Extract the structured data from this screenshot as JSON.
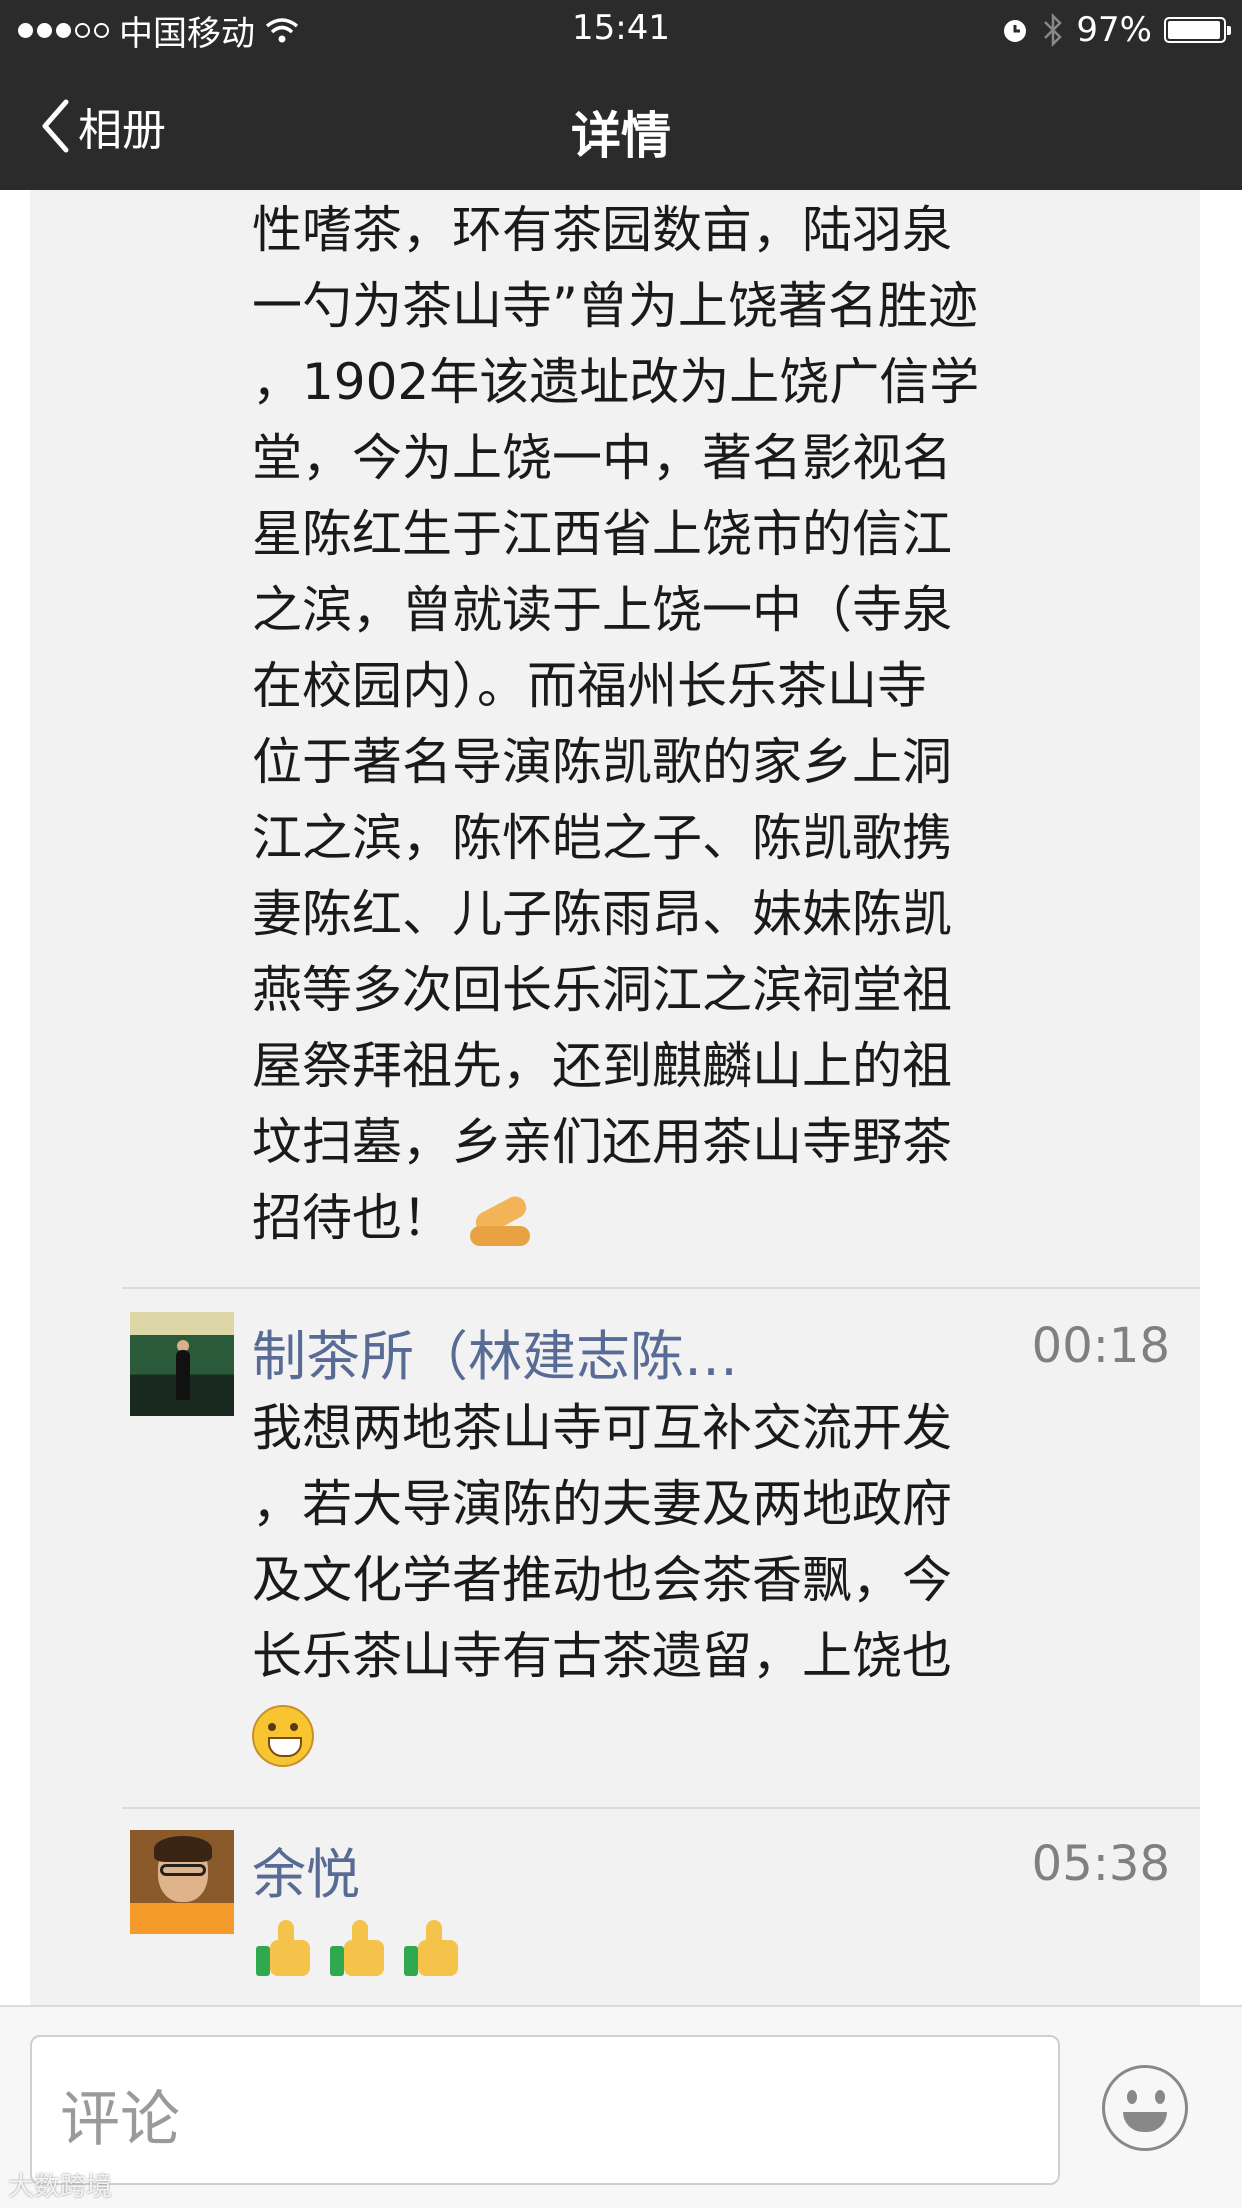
{
  "status_bar": {
    "carrier": "中国移动",
    "time": "15:41",
    "battery_percent": "97%",
    "battery_level": 0.97
  },
  "nav": {
    "back_label": "相册",
    "title": "详情"
  },
  "post": {
    "text": "性嗜茶，环有茶园数亩，陆羽泉\n一勺为茶山寺”曾为上饶著名胜迹\n，1902年该遗址改为上饶广信学\n堂，今为上饶一中，著名影视名\n星陈红生于江西省上饶市的信江\n之滨，曾就读于上饶一中（寺泉\n在校园内）。而福州长乐茶山寺\n位于著名导演陈凯歌的家乡上洞\n江之滨，陈怀皑之子、陈凯歌携\n妻陈红、儿子陈雨昂、妹妹陈凯\n燕等多次回长乐洞江之滨祠堂祖\n屋祭拜祖先，还到麒麟山上的祖\n坟扫墓，乡亲们还用茶山寺野茶\n招待也！",
    "trailing_emoji": "pray-hands-emoji"
  },
  "comments": [
    {
      "name": "制茶所（林建志陈彬藩家...",
      "time": "00:18",
      "text": "我想两地茶山寺可互补交流开发\n，若大导演陈的夫妻及两地政府\n及文化学者推动也会茶香飘，今\n长乐茶山寺有古茶遗留，上饶也",
      "emoji": "grin-emoji"
    },
    {
      "name": "余悦",
      "time": "05:38",
      "emoji": "thumbs-up-emoji",
      "emoji_count": 3
    }
  ],
  "comment_bar": {
    "placeholder": "评论",
    "emoji_button_icon": "smiley-icon"
  },
  "watermark": "大数跨境"
}
